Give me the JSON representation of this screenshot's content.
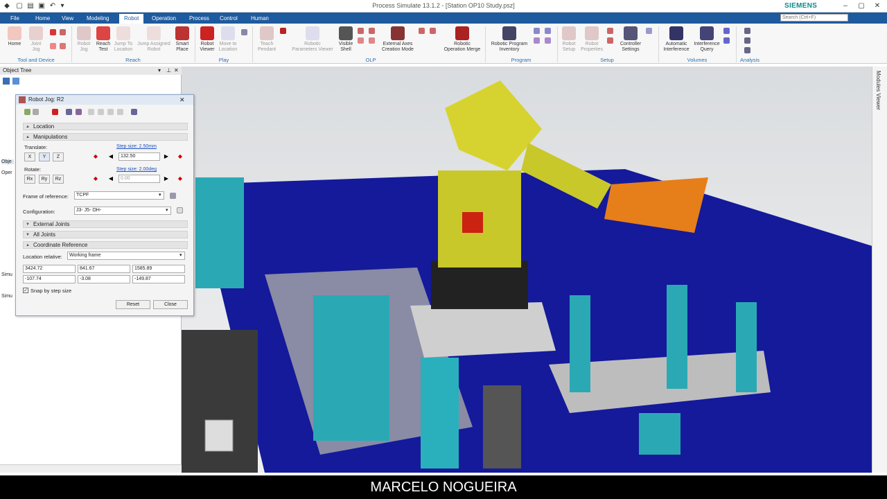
{
  "window": {
    "title": "Process Simulate 13.1.2 - [Station OP10 Study.psz]",
    "brand": "SIEMENS",
    "search_placeholder": "Search (Ctrl+F)"
  },
  "tabs": [
    "File",
    "Home",
    "View",
    "Modeling",
    "Robot",
    "Operation",
    "Process",
    "Control",
    "Human"
  ],
  "active_tab": "Robot",
  "ribbon": {
    "groups": [
      {
        "label": "Tool and Device",
        "items": [
          "Home",
          "Joint\nJog",
          "",
          ""
        ]
      },
      {
        "label": "Reach",
        "items": [
          "Robot\nJog",
          "Reach\nTest",
          "Jump To\nLocation",
          "Jump Assigned\nRobot",
          "Smart\nPlace"
        ]
      },
      {
        "label": "Play",
        "items": [
          "Robot\nViewer",
          "Move to\nLocation"
        ]
      },
      {
        "label": "OLP",
        "items": [
          "Teach\nPendant",
          "Robotic\nParameters Viewer",
          "Visible\nShell",
          "External Axes\nCreation Mode",
          "Robotic\nOperation Merge"
        ]
      },
      {
        "label": "Program",
        "items": [
          "Robotic Program\nInventory"
        ]
      },
      {
        "label": "Setup",
        "items": [
          "Robot\nSetup",
          "Robot\nProperties",
          "Controller\nSettings"
        ]
      },
      {
        "label": "Volumes",
        "items": [
          "Automatic\nInterference",
          "Interference\nQuery"
        ]
      },
      {
        "label": "Analysis",
        "items": []
      }
    ]
  },
  "object_tree": {
    "title": "Object Tree"
  },
  "side_tab": "Modules Viewer",
  "dialog": {
    "title": "Robot Jog: R2",
    "sections": {
      "location": "Location",
      "manipulations": "Manipulations",
      "external_joints": "External Joints",
      "all_joints": "All Joints",
      "coordinate_reference": "Coordinate Reference"
    },
    "translate": {
      "label": "Translate:",
      "axes": [
        "X",
        "Y",
        "Z"
      ],
      "step": "Step size: 2.50mm",
      "value": "132.50"
    },
    "rotate": {
      "label": "Rotate:",
      "axes": [
        "Rx",
        "Ry",
        "Rz"
      ],
      "step": "Step size: 2.00deg",
      "value": "0.00"
    },
    "frame_of_reference": {
      "label": "Frame of reference:",
      "value": "TCPF"
    },
    "configuration": {
      "label": "Configuration:",
      "value": "J3- J5- OH-"
    },
    "location_relative": {
      "label": "Location relative:",
      "value": "Working frame"
    },
    "coords": [
      "3424.72",
      "841.67",
      "1585.89",
      "-107.74",
      "-3.08",
      "-149.87"
    ],
    "snap": "Snap by step size",
    "reset": "Reset",
    "close": "Close"
  },
  "left_labels": [
    "Obje",
    "Oper",
    "Simu",
    "Simu"
  ],
  "caption": "MARCELO NOGUEIRA"
}
